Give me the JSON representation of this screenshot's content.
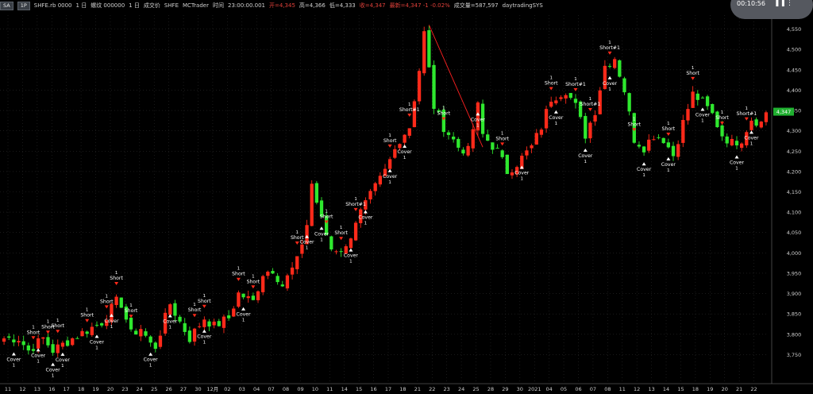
{
  "toolbar": {
    "items": [
      {
        "label": "SA",
        "style": "btn"
      },
      {
        "label": "1P",
        "style": "btn"
      },
      {
        "label": "SHFE.rb 0000",
        "style": "text"
      },
      {
        "label": "1 日",
        "style": "text"
      },
      {
        "label": "螺纹 000000",
        "style": "text"
      },
      {
        "label": "1 日",
        "style": "text"
      },
      {
        "label": "成交价",
        "style": "text"
      },
      {
        "label": "SHFE",
        "style": "text"
      },
      {
        "label": "MCTrader",
        "style": "text"
      },
      {
        "label": "时间",
        "style": "text"
      },
      {
        "label": "23:00:00.001",
        "style": "text"
      },
      {
        "label": "开=4,345",
        "style": "red"
      },
      {
        "label": "高=4,366",
        "style": "text"
      },
      {
        "label": "低=4,333",
        "style": "text"
      },
      {
        "label": "收=4,347",
        "style": "red"
      },
      {
        "label": "最新=4,347 -1 -0.02%",
        "style": "red"
      },
      {
        "label": "成交量=587,597",
        "style": "text"
      },
      {
        "label": "daytradingSYS",
        "style": "text"
      }
    ]
  },
  "timer": {
    "text": "00:10:56",
    "icons": [
      "pause-icon",
      "more-icon"
    ]
  },
  "chart_data": {
    "type": "candlestick",
    "y_range": [
      3700,
      4600
    ],
    "y_ticks": [
      "4,600",
      "4,550",
      "4,500",
      "4,450",
      "4,400",
      "4,350",
      "4,300",
      "4,250",
      "4,200",
      "4,150",
      "4,100",
      "4,050",
      "4,000",
      "3,950",
      "3,900",
      "3,850",
      "3,800",
      "3,750"
    ],
    "last_price_label": "4,347",
    "last_price": 4347,
    "x_labels": [
      "11",
      "12",
      "13",
      "16",
      "17",
      "18",
      "19",
      "20",
      "23",
      "24",
      "25",
      "26",
      "27",
      "30",
      "12月",
      "02",
      "03",
      "04",
      "07",
      "08",
      "09",
      "10",
      "11",
      "14",
      "15",
      "16",
      "17",
      "18",
      "21",
      "22",
      "23",
      "24",
      "25",
      "28",
      "29",
      "30",
      "2021",
      "04",
      "05",
      "06",
      "07",
      "08",
      "11",
      "12",
      "13",
      "14",
      "15",
      "18",
      "19",
      "20",
      "21",
      "22"
    ],
    "path_points": [
      [
        0,
        3790
      ],
      [
        3,
        3790
      ],
      [
        5,
        3760
      ],
      [
        8,
        3790
      ],
      [
        10,
        3760
      ],
      [
        12,
        3775
      ],
      [
        14,
        3790
      ],
      [
        17,
        3810
      ],
      [
        20,
        3830
      ],
      [
        23,
        3880
      ],
      [
        24,
        3875
      ],
      [
        26,
        3800
      ],
      [
        28,
        3815
      ],
      [
        30,
        3775
      ],
      [
        31,
        3770
      ],
      [
        34,
        3875
      ],
      [
        36,
        3830
      ],
      [
        38,
        3790
      ],
      [
        41,
        3840
      ],
      [
        43,
        3820
      ],
      [
        46,
        3840
      ],
      [
        48,
        3900
      ],
      [
        51,
        3880
      ],
      [
        53,
        3950
      ],
      [
        55,
        3960
      ],
      [
        57,
        3920
      ],
      [
        60,
        3980
      ],
      [
        62,
        4070
      ],
      [
        63,
        4170
      ],
      [
        65,
        4080
      ],
      [
        67,
        4010
      ],
      [
        70,
        4010
      ],
      [
        72,
        4080
      ],
      [
        75,
        4140
      ],
      [
        78,
        4200
      ],
      [
        81,
        4280
      ],
      [
        83,
        4310
      ],
      [
        85,
        4450
      ],
      [
        86,
        4540
      ],
      [
        88,
        4360
      ],
      [
        90,
        4310
      ],
      [
        93,
        4260
      ],
      [
        95,
        4250
      ],
      [
        97,
        4360
      ],
      [
        98,
        4290
      ],
      [
        101,
        4250
      ],
      [
        103,
        4200
      ],
      [
        105,
        4220
      ],
      [
        108,
        4260
      ],
      [
        110,
        4310
      ],
      [
        112,
        4380
      ],
      [
        115,
        4400
      ],
      [
        117,
        4360
      ],
      [
        119,
        4290
      ],
      [
        121,
        4350
      ],
      [
        123,
        4460
      ],
      [
        125,
        4480
      ],
      [
        127,
        4400
      ],
      [
        129,
        4280
      ],
      [
        131,
        4260
      ],
      [
        133,
        4290
      ],
      [
        135,
        4280
      ],
      [
        137,
        4240
      ],
      [
        139,
        4320
      ],
      [
        141,
        4390
      ],
      [
        143,
        4370
      ],
      [
        145,
        4340
      ],
      [
        147,
        4290
      ],
      [
        149,
        4270
      ],
      [
        151,
        4280
      ],
      [
        153,
        4330
      ],
      [
        155,
        4320
      ],
      [
        156,
        4347
      ]
    ],
    "markers": [
      {
        "bar": 6,
        "label": "Short",
        "type": "short"
      },
      {
        "bar": 9,
        "label": "Short",
        "type": "short"
      },
      {
        "bar": 11,
        "label": "Short",
        "type": "short"
      },
      {
        "bar": 17,
        "label": "Short",
        "type": "short"
      },
      {
        "bar": 21,
        "label": "Short",
        "type": "short"
      },
      {
        "bar": 23,
        "label": "Short",
        "type": "short"
      },
      {
        "bar": 26,
        "label": "Short",
        "type": "short"
      },
      {
        "bar": 39,
        "label": "Short",
        "type": "short"
      },
      {
        "bar": 41,
        "label": "Short",
        "type": "short"
      },
      {
        "bar": 48,
        "label": "Short",
        "type": "short"
      },
      {
        "bar": 51,
        "label": "Short",
        "type": "short"
      },
      {
        "bar": 60,
        "label": "Short",
        "type": "short"
      },
      {
        "bar": 66,
        "label": "Short",
        "type": "short"
      },
      {
        "bar": 69,
        "label": "Short",
        "type": "short"
      },
      {
        "bar": 72,
        "label": "Short#1",
        "type": "short"
      },
      {
        "bar": 79,
        "label": "Short",
        "type": "short"
      },
      {
        "bar": 83,
        "label": "Short#1",
        "type": "short"
      },
      {
        "bar": 90,
        "label": "Short",
        "type": "short"
      },
      {
        "bar": 102,
        "label": "Short",
        "type": "short"
      },
      {
        "bar": 112,
        "label": "Short",
        "type": "short"
      },
      {
        "bar": 117,
        "label": "Short#1",
        "type": "short"
      },
      {
        "bar": 120,
        "label": "Short#1",
        "type": "short"
      },
      {
        "bar": 124,
        "label": "Short#1",
        "type": "short"
      },
      {
        "bar": 129,
        "label": "Short",
        "type": "short"
      },
      {
        "bar": 136,
        "label": "Short",
        "type": "short"
      },
      {
        "bar": 141,
        "label": "Short",
        "type": "short"
      },
      {
        "bar": 147,
        "label": "Short",
        "type": "short"
      },
      {
        "bar": 152,
        "label": "Short#1",
        "type": "short"
      },
      {
        "bar": 2,
        "label": "Cover",
        "type": "cover"
      },
      {
        "bar": 7,
        "label": "Cover",
        "type": "cover"
      },
      {
        "bar": 10,
        "label": "Cover",
        "type": "cover"
      },
      {
        "bar": 12,
        "label": "Cover",
        "type": "cover"
      },
      {
        "bar": 19,
        "label": "Cover",
        "type": "cover"
      },
      {
        "bar": 22,
        "label": "Cover",
        "type": "cover"
      },
      {
        "bar": 30,
        "label": "Cover",
        "type": "cover"
      },
      {
        "bar": 34,
        "label": "Cover",
        "type": "cover"
      },
      {
        "bar": 41,
        "label": "Cover",
        "type": "cover"
      },
      {
        "bar": 49,
        "label": "Cover",
        "type": "cover"
      },
      {
        "bar": 62,
        "label": "Cover",
        "type": "cover"
      },
      {
        "bar": 65,
        "label": "Cover",
        "type": "cover"
      },
      {
        "bar": 71,
        "label": "Cover",
        "type": "cover"
      },
      {
        "bar": 74,
        "label": "Cover",
        "type": "cover"
      },
      {
        "bar": 79,
        "label": "Cover",
        "type": "cover"
      },
      {
        "bar": 82,
        "label": "Cover",
        "type": "cover"
      },
      {
        "bar": 97,
        "label": "Cover",
        "type": "cover"
      },
      {
        "bar": 106,
        "label": "Cover",
        "type": "cover"
      },
      {
        "bar": 113,
        "label": "Cover",
        "type": "cover"
      },
      {
        "bar": 119,
        "label": "Cover",
        "type": "cover"
      },
      {
        "bar": 124,
        "label": "Cover",
        "type": "cover"
      },
      {
        "bar": 131,
        "label": "Cover",
        "type": "cover"
      },
      {
        "bar": 136,
        "label": "Cover",
        "type": "cover"
      },
      {
        "bar": 143,
        "label": "Cover",
        "type": "cover"
      },
      {
        "bar": 150,
        "label": "Cover",
        "type": "cover"
      },
      {
        "bar": 153,
        "label": "Cover",
        "type": "cover"
      }
    ],
    "trend_line": {
      "from": [
        4560,
        87
      ],
      "to": [
        4260,
        98
      ]
    },
    "colors": {
      "up": "#ff2a1a",
      "down": "#2ee82e",
      "axis": "#cfcfcf",
      "grid": "#2a2a2a",
      "last_price_bg": "#20b030"
    }
  }
}
